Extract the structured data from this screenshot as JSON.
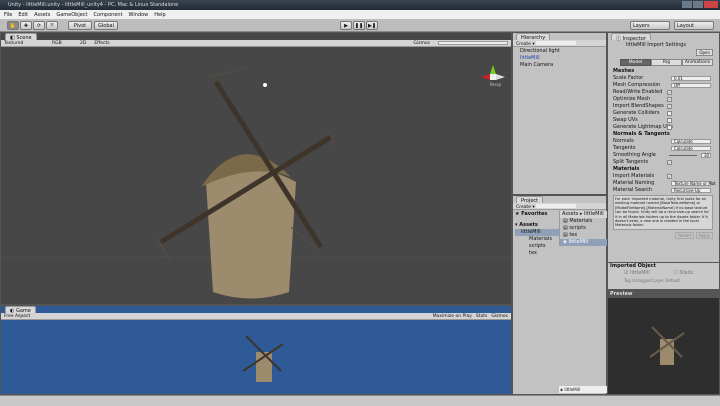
{
  "window": {
    "title": "Unity - littleMill.unity - littleMill_unity4 - PC, Mac & Linux Standalone"
  },
  "menu": [
    "File",
    "Edit",
    "Assets",
    "GameObject",
    "Component",
    "Window",
    "Help"
  ],
  "toolbar": {
    "pivot": "Pivot",
    "global": "Global",
    "layers": "Layers",
    "layout": "Layout"
  },
  "scene": {
    "tab": "Scene",
    "render_mode": "Textured",
    "color_mode": "RGB",
    "mode_2d": "2D",
    "effects": "Effects",
    "gizmos": "Gizmos",
    "persp": "Persp"
  },
  "game": {
    "tab": "Game",
    "aspect": "Free Aspect",
    "maximize": "Maximize on Play",
    "stats": "Stats",
    "gizmos": "Gizmos"
  },
  "hierarchy": {
    "tab": "Hierarchy",
    "create": "Create",
    "items": [
      "Directional light",
      "littleMill",
      "Main Camera"
    ]
  },
  "project": {
    "tab": "Project",
    "create": "Create",
    "favorites": "Favorites",
    "assets": "Assets",
    "breadcrumb": [
      "Assets",
      "littleMill"
    ],
    "tree": [
      "littleMill",
      "Materials",
      "scripts",
      "tex"
    ],
    "files": [
      "Materials",
      "scripts",
      "tex",
      "littleMill"
    ],
    "footer": "littleMill"
  },
  "inspector": {
    "tab": "Inspector",
    "title": "littleMill Import Settings",
    "open": "Open",
    "tabs": [
      "Model",
      "Rig",
      "Animations"
    ],
    "meshes": "Meshes",
    "fields": [
      {
        "label": "Scale Factor",
        "value": "0.01",
        "type": "text"
      },
      {
        "label": "Mesh Compression",
        "value": "Off",
        "type": "select"
      },
      {
        "label": "Read/Write Enabled",
        "value": true,
        "type": "check"
      },
      {
        "label": "Optimize Mesh",
        "value": true,
        "type": "check"
      },
      {
        "label": "Import BlendShapes",
        "value": true,
        "type": "check"
      },
      {
        "label": "Generate Colliders",
        "value": false,
        "type": "check"
      },
      {
        "label": "Swap UVs",
        "value": false,
        "type": "check"
      },
      {
        "label": "Generate Lightmap UVs",
        "value": false,
        "type": "check"
      }
    ],
    "normals_title": "Normals & Tangents",
    "normals": [
      {
        "label": "Normals",
        "value": "Calculate",
        "type": "select"
      },
      {
        "label": "Tangents",
        "value": "Calculate",
        "type": "select"
      },
      {
        "label": "Smoothing Angle",
        "value": "30",
        "type": "slider"
      },
      {
        "label": "Split Tangents",
        "value": true,
        "type": "check"
      }
    ],
    "materials_title": "Materials",
    "materials": [
      {
        "label": "Import Materials",
        "value": true,
        "type": "check"
      },
      {
        "label": "Material Naming",
        "value": "Texture Name or Mat",
        "type": "select"
      },
      {
        "label": "Material Search",
        "value": "Recursive-Up",
        "type": "select"
      }
    ],
    "help": "For each imported material, Unity first looks for an existing material named [BaseTextureName] or [ModelFileName]-[MaterialName] if no base texture can be found. Unity will do a recursive-up search for it in all Materials folders up to the Assets folder. If it doesn't exist, a new one is created in the local Materials folder.",
    "revert": "Revert",
    "apply": "Apply",
    "imported_title": "Imported Object",
    "imported_name": "littleMill",
    "static": "Static",
    "tag_label": "Tag",
    "tag": "Untagged",
    "layer_label": "Layer",
    "layer": "Default",
    "preview": "Preview"
  },
  "colors": {
    "scene_bg": "#474747",
    "game_bg": "#2f5a98",
    "panel": "#c2c2c2"
  }
}
